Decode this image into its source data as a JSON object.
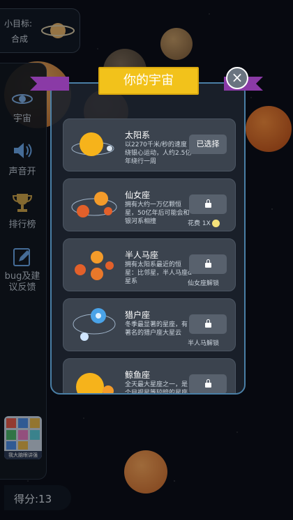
{
  "hud": {
    "goal_label": "小目标:",
    "goal_value": "合成",
    "score": "得分:13"
  },
  "sidebar": {
    "items": [
      {
        "label": "宇宙",
        "icon": "galaxy-icon"
      },
      {
        "label": "声音开",
        "icon": "speaker-icon"
      },
      {
        "label": "排行榜",
        "icon": "trophy-icon"
      },
      {
        "label": "bug及建议反馈",
        "icon": "edit-icon"
      }
    ],
    "ad_caption": "我大脑眼讲强"
  },
  "dialog": {
    "title": "你的宇宙",
    "close_icon": "close-icon",
    "cards": [
      {
        "name": "太阳系",
        "desc": "以2270千米/秒的速度绕银心运动，人约2.5亿年绕行一周",
        "button": "已选择",
        "locked": false,
        "requirement": ""
      },
      {
        "name": "仙女座",
        "desc": "拥有大约一万亿颗恒星，50亿年后可能会和银河系相撞",
        "button": "",
        "locked": true,
        "requirement": "花费 1X"
      },
      {
        "name": "半人马座",
        "desc": "拥有太阳系最近的恒星：比邻星，半人马座α星系",
        "button": "",
        "locked": true,
        "requirement": "仙女座解锁"
      },
      {
        "name": "猎户座",
        "desc": "冬季最显著的星座，有著名的猎户座大星云",
        "button": "",
        "locked": true,
        "requirement": "半人马解锁"
      },
      {
        "name": "鲸鱼座",
        "desc": "全天最大星座之一，是个目视星等较暗的星座",
        "button": "",
        "locked": true,
        "requirement": ""
      }
    ]
  },
  "colors": {
    "accent_yellow": "#f2c21b",
    "ribbon_purple": "#8a3aa6",
    "panel_border": "#4a7fa6"
  }
}
